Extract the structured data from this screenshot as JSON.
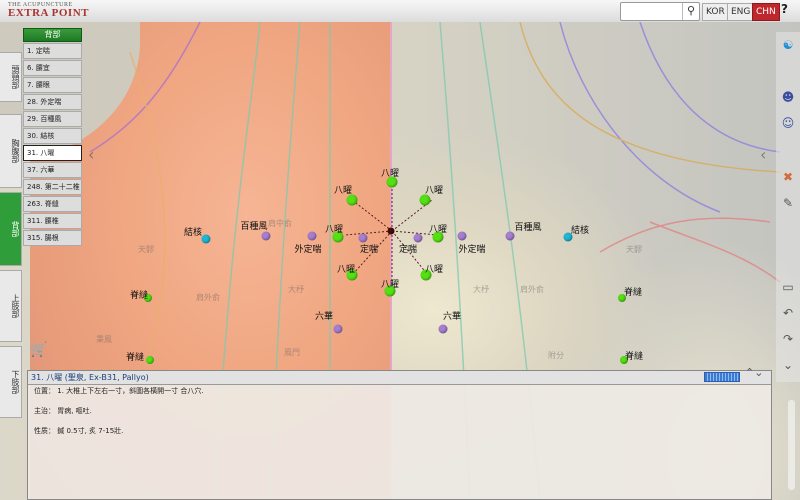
{
  "app": {
    "logo_line1": "THE ACUPUNCTURE",
    "logo_line2": "EXTRA POINT"
  },
  "toolbar": {
    "search_value": "",
    "search_icon": "magnifier-icon",
    "languages": [
      "KOR",
      "ENG",
      "CHN"
    ],
    "active_language": "CHN",
    "help_label": "?"
  },
  "category_tabs": [
    "頭頸部",
    "胸腹部",
    "背部",
    "上肢部",
    "下肢部"
  ],
  "active_category": "背部",
  "acupoint_list": {
    "header": "背部",
    "items": [
      "1. 定喘",
      "6. 腰宜",
      "7. 腰眼",
      "28. 外定喘",
      "29. 百種風",
      "30. 結核",
      "31. 八曜",
      "37. 六華",
      "248. 第二十二椎",
      "263. 脊縫",
      "311. 腰椎",
      "315. 腸根"
    ],
    "selected_index": 6
  },
  "points": {
    "bahua": "八曜",
    "dingchuan": "定喘",
    "waidingchuan": "外定喘",
    "baizhongfeng": "百種風",
    "jiehe": "結核",
    "liuhua": "六華",
    "jifeng": "脊縫"
  },
  "faint_labels": [
    "天髎",
    "肩中俞",
    "肩外俞",
    "大杼",
    "風門",
    "秉風",
    "曲垣",
    "天宗",
    "附分"
  ],
  "info": {
    "title": "31. 八曜 (聖泉, Ex-B31, Pallyo)",
    "location_label": "位置：",
    "location_text": "1. 大椎上下左右一寸，斜圍各橫開一寸 合八穴.",
    "indication_label": "主治：",
    "indication_text": "胃病, 嘔吐.",
    "method_label": "性质：",
    "method_text": "鍼 0.5寸, 炙 7-15壯."
  },
  "tools": [
    "body-view-icon",
    "person-r-icon",
    "person-l-icon",
    "chevron-left-icon",
    "needle-icon",
    "pencil-icon",
    "eraser-icon",
    "undo-icon",
    "redo-icon",
    "chevron-down-icon"
  ],
  "colors": {
    "accent_green": "#2f9d3a",
    "active_lang": "#c0272d",
    "point_green": "#55e013",
    "point_purple": "#a77ed0",
    "point_cyan": "#1fb7d5"
  }
}
